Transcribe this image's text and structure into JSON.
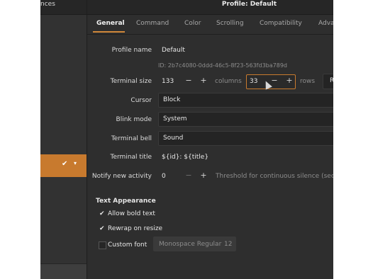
{
  "sidebar": {
    "title": "nces",
    "selected_check": "✔",
    "selected_caret": "▾"
  },
  "window": {
    "title": "Profile: Default"
  },
  "tabs": [
    "General",
    "Command",
    "Color",
    "Scrolling",
    "Compatibility",
    "Adva"
  ],
  "general": {
    "profile_name_label": "Profile name",
    "profile_name_value": "Default",
    "profile_id": "ID: 2b7c4080-0ddd-46c5-8f23-563fd3ba789d",
    "terminal_size_label": "Terminal size",
    "columns_value": "133",
    "columns_label": "columns",
    "rows_value": "33",
    "rows_label": "rows",
    "reset_label": "R",
    "minus": "−",
    "plus": "+",
    "cursor_label": "Cursor",
    "cursor_value": "Block",
    "blink_label": "Blink mode",
    "blink_value": "System",
    "bell_label": "Terminal bell",
    "bell_value": "Sound",
    "terminal_title_label": "Terminal title",
    "terminal_title_value": "${id}: ${title}",
    "notify_label": "Notify new activity",
    "notify_value": "0",
    "notify_hint": "Threshold for continuous silence (seco"
  },
  "appearance": {
    "section_title": "Text Appearance",
    "bold_label": "Allow bold text",
    "rewrap_label": "Rewrap on resize",
    "custom_font_label": "Custom font",
    "font_name": "Monospace Regular",
    "font_size": "12",
    "check_glyph": "✔"
  }
}
